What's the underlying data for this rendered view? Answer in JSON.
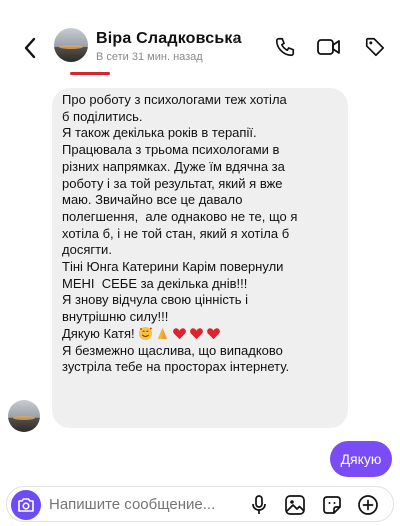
{
  "header": {
    "contact_name": "Віра Сладковська",
    "chevron": "›",
    "status": "В сети 31 мин. назад"
  },
  "message_in": {
    "lines": [
      "Про роботу з психологами теж хотіла",
      "б поділитись.",
      "Я також декілька років в терапії.",
      "Працювала з трьома психологами в",
      "різних напрямках. Дуже їм вдячна за",
      "роботу і за той результат, який я вже",
      "маю. Звичайно все це давало",
      "полегшення,  але однаково не те, що я",
      "хотіла б, і не той стан, який я хотіла б",
      "досягти.",
      "Тіні Юнга Катерини Карім повернули",
      "МЕНІ  СЕБЕ за декілька днів!!!",
      "Я знову відчула свою цінність і",
      "внутрішню силу!!!",
      "Дякую Катя!",
      "Я безмежно щаслива, що випадково",
      "зустріла тебе на просторах інтернету."
    ],
    "emojis": [
      "smiling-face-with-hearts",
      "folded-hands",
      "red-heart",
      "red-heart",
      "red-heart"
    ]
  },
  "message_out": {
    "text": "Дякую"
  },
  "composer": {
    "placeholder": "Напишите сообщение..."
  },
  "colors": {
    "accent": "#7a4cf5",
    "bubble_in": "#efefef",
    "status": "#8a8a8a"
  },
  "icons": [
    "back-arrow-icon",
    "phone-icon",
    "video-camera-icon",
    "tag-icon",
    "camera-icon",
    "microphone-icon",
    "gallery-icon",
    "sticker-icon",
    "plus-icon"
  ]
}
